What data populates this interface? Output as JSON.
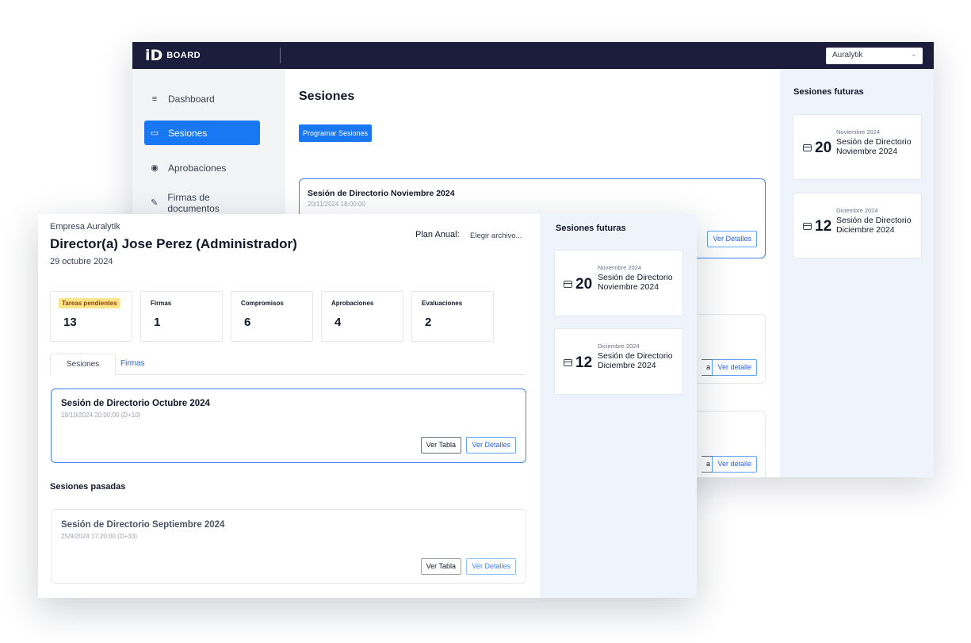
{
  "brand": {
    "logo_glyph": "iD",
    "name": "BOARD"
  },
  "company_select": {
    "value": "Auralytik"
  },
  "sidebar": {
    "items": [
      {
        "label": "Dashboard",
        "icon": "list-icon",
        "active": false
      },
      {
        "label": "Sesiones",
        "icon": "folder-icon",
        "active": true
      },
      {
        "label": "Aprobaciones",
        "icon": "eye-icon",
        "active": false
      },
      {
        "label": "Firmas de documentos",
        "icon": "document-sign-icon",
        "active": false
      }
    ]
  },
  "main": {
    "title": "Sesiones",
    "schedule_button": "Programar Sesiones",
    "session_card": {
      "title": "Sesión de Directorio Noviembre 2024",
      "datetime": "20/11/2024 18:00:00",
      "details_button": "Ver Detalles"
    },
    "card2_details_button": "Ver detalle",
    "card2_partial_button": "a",
    "card3_details_button": "Ver detalle",
    "card3_partial_button": "a"
  },
  "back_panel": {
    "title": "Sesiones futuras",
    "items": [
      {
        "month": "Noviembre 2024",
        "day": "20",
        "name": "Sesión de Directorio Noviembre 2024"
      },
      {
        "month": "Diciembre 2024",
        "day": "12",
        "name": "Sesión de Directorio Diciembre 2024"
      }
    ]
  },
  "front": {
    "company": "Empresa Auralytik",
    "user": "Director(a) Jose Perez (Administrador)",
    "date": "29 octubre 2024",
    "plan_label": "Plan Anual:",
    "plan_file": "Elegir archivo...",
    "stats": [
      {
        "label": "Tareas pendientes",
        "value": "13",
        "highlight": true
      },
      {
        "label": "Firmas",
        "value": "1",
        "highlight": false
      },
      {
        "label": "Compromisos",
        "value": "6",
        "highlight": false
      },
      {
        "label": "Aprobaciones",
        "value": "4",
        "highlight": false
      },
      {
        "label": "Evaluaciones",
        "value": "2",
        "highlight": false
      }
    ],
    "tabs": [
      {
        "label": "Sesiones",
        "active": true
      },
      {
        "label": "Firmas",
        "active": false
      }
    ],
    "current_session": {
      "title": "Sesión de Directorio Octubre 2024",
      "datetime": "18/10/2024 20:00:00 (D+10)",
      "table_button": "Ver Tabla",
      "details_button": "Ver Detalles"
    },
    "past_label": "Sesiones pasadas",
    "past_session": {
      "title": "Sesión de Directorio Septiembre 2024",
      "datetime": "25/9/2024 17:20:00 (D+33)",
      "table_button": "Ver Tabla",
      "details_button": "Ver Detalles"
    },
    "panel": {
      "title": "Sesiones futuras",
      "items": [
        {
          "month": "Noviembre 2024",
          "day": "20",
          "name": "Sesión de Directorio Noviembre 2024"
        },
        {
          "month": "Diciembre 2024",
          "day": "12",
          "name": "Sesión de Directorio Diciembre 2024"
        }
      ]
    }
  },
  "colors": {
    "topbar": "#1c1d3d",
    "accent": "#1877f2",
    "panel_bg": "#eef3fc",
    "badge": "#fde68a"
  }
}
